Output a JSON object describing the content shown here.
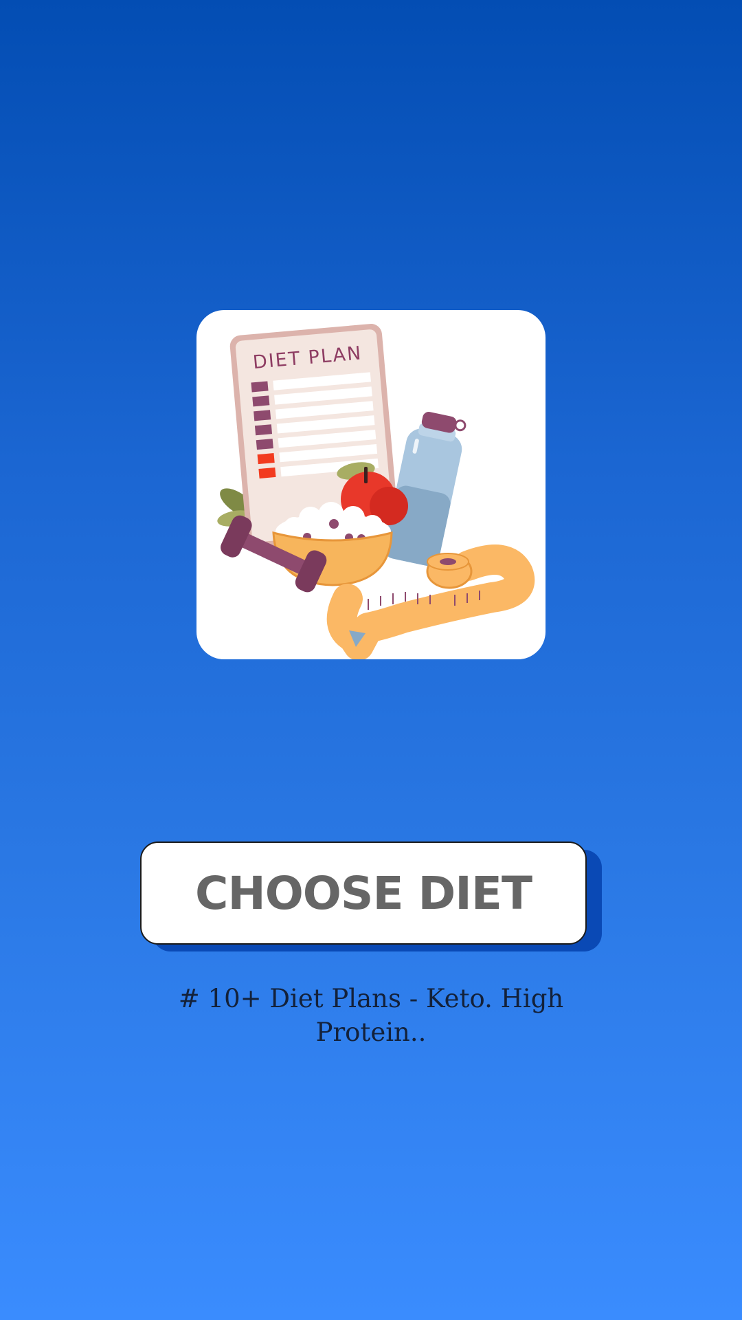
{
  "hero": {
    "illustration_icon": "diet-plan-illustration",
    "clipboard_title": "DIET PLAN",
    "colors": {
      "card": "#ffffff",
      "clipboard": "#dcb3ac",
      "paper": "#f4e6e0",
      "checkbox": "#8e4a6e",
      "checkbox_alert": "#f23b1f",
      "apple": "#e8382a",
      "bowl": "#f7b55c",
      "bottle": "#a9c6df",
      "dumbbell": "#8e4a6e",
      "tape": "#fbb865",
      "leaf": "#9aa35b"
    }
  },
  "cta": {
    "button_label": "CHOOSE DIET"
  },
  "subtitle": {
    "text": "# 10+ Diet Plans - Keto. High Protein.."
  },
  "theme": {
    "background_top": "#034db3",
    "background_bottom": "#3a8cfe",
    "button_shadow": "#0a49b5",
    "button_text": "#666666",
    "subtitle_text": "#13213a"
  }
}
